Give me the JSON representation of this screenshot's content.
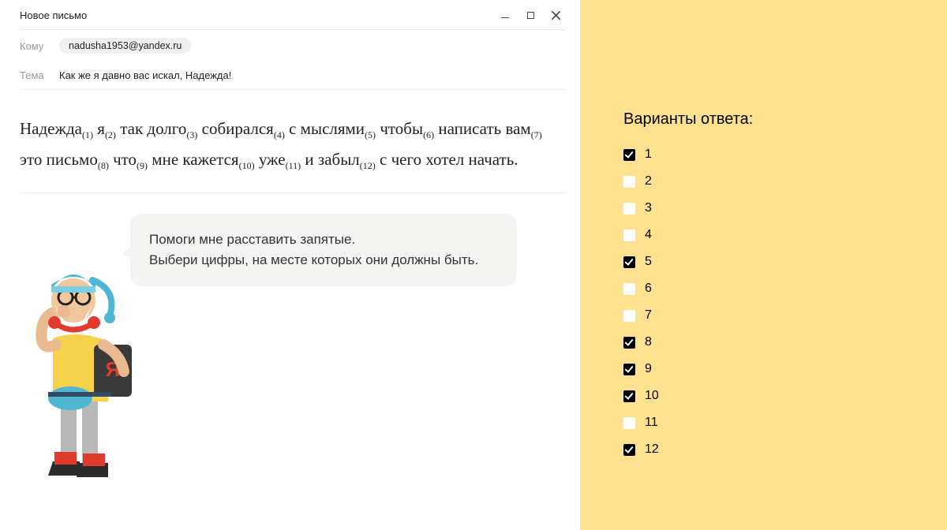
{
  "window": {
    "title": "Новое письмо"
  },
  "fields": {
    "to_label": "Кому",
    "to_chip": "nadusha1953@yandex.ru",
    "subject_label": "Тема",
    "subject_value": "Как же я давно вас искал, Надежда!"
  },
  "body": {
    "w1": "Надежда",
    "s1": "(1)",
    "w2": " я",
    "s2": "(2)",
    "w3": " так долго",
    "s3": "(3)",
    "w4": " собирался",
    "s4": "(4)",
    "w5": " с мыслями",
    "s5": "(5)",
    "w6": " чтобы",
    "s6": "(6)",
    "w7": " написать вам",
    "s7": "(7)",
    "w8": " это письмо",
    "s8": "(8)",
    "w9": " что",
    "s9": "(9)",
    "w10": " мне кажется",
    "s10": "(10)",
    "w11": " уже",
    "s11": "(11)",
    "w12": " и забыл",
    "s12": "(12)",
    "tail": " с чего хотел начать."
  },
  "speech": {
    "line1": "Помоги мне расставить запятые.",
    "line2": "Выбери цифры, на месте которых они должны быть."
  },
  "answers": {
    "title": "Варианты ответа:",
    "options": [
      {
        "label": "1",
        "checked": true
      },
      {
        "label": "2",
        "checked": false
      },
      {
        "label": "3",
        "checked": false
      },
      {
        "label": "4",
        "checked": false
      },
      {
        "label": "5",
        "checked": true
      },
      {
        "label": "6",
        "checked": false
      },
      {
        "label": "7",
        "checked": false
      },
      {
        "label": "8",
        "checked": true
      },
      {
        "label": "9",
        "checked": true
      },
      {
        "label": "10",
        "checked": true
      },
      {
        "label": "11",
        "checked": false
      },
      {
        "label": "12",
        "checked": true
      }
    ]
  }
}
